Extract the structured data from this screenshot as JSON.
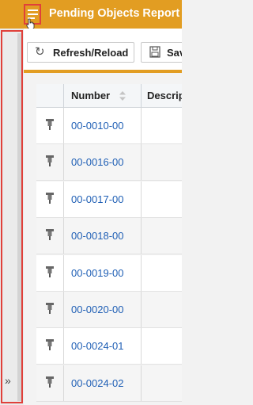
{
  "header": {
    "title": "Pending Objects Report",
    "bg_color": "#e29d22",
    "menu_icon": "hamburger-menu-icon"
  },
  "toolbar": {
    "refresh_label": "Refresh/Reload",
    "save_label": "Sav"
  },
  "sidebar": {
    "expand_label": "»"
  },
  "grid": {
    "columns": [
      "",
      "Number",
      "Descrip"
    ],
    "rows": [
      {
        "number": "00-0010-00"
      },
      {
        "number": "00-0016-00"
      },
      {
        "number": "00-0017-00"
      },
      {
        "number": "00-0018-00"
      },
      {
        "number": "00-0019-00"
      },
      {
        "number": "00-0020-00"
      },
      {
        "number": "00-0024-01"
      },
      {
        "number": "00-0024-02"
      }
    ]
  }
}
